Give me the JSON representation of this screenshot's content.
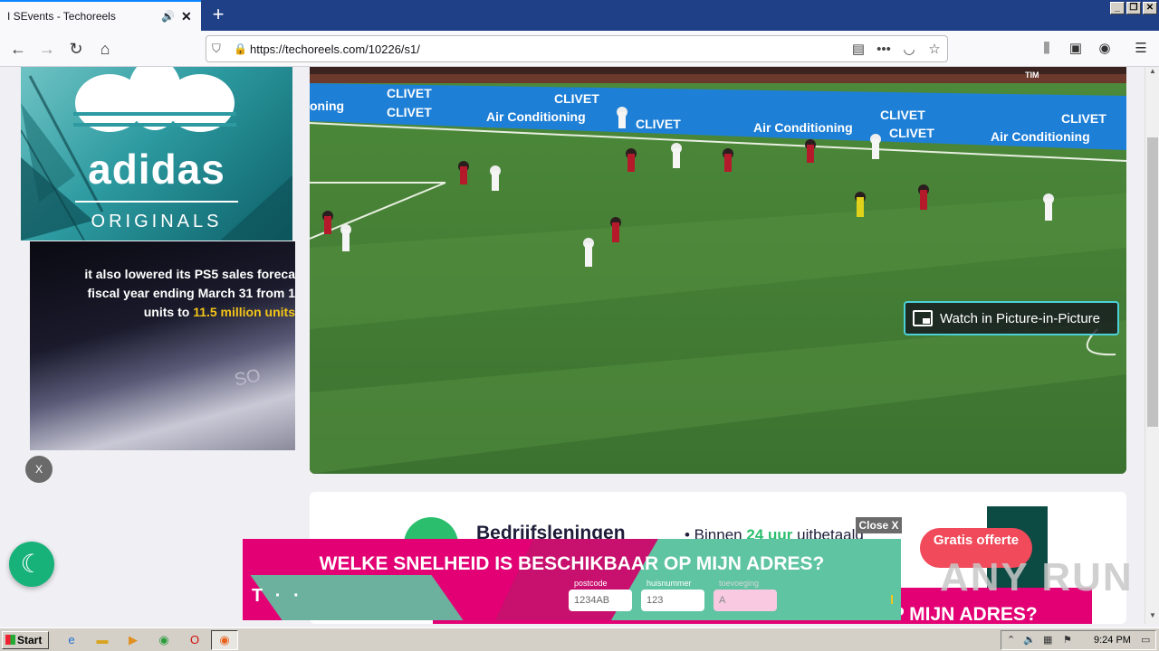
{
  "browser": {
    "tab_title": "I SEvents - Techoreels",
    "tab_speaker_icon": "speaker-icon",
    "tab_close": "✕",
    "new_tab": "+",
    "url": "https://techoreels.com/10226/s1/",
    "window_controls": [
      "_",
      "❐",
      "✕"
    ]
  },
  "ads": {
    "adidas_brand": "adidas",
    "adidas_sub": "ORIGINALS",
    "ps5_line1": "it also lowered its PS5 sales foreca",
    "ps5_line2": "fiscal year ending March 31 from 1",
    "ps5_line3_a": "units",
    "ps5_line3_b": "to",
    "ps5_line3_c": "11.5 million units",
    "ps5_logo": "SO",
    "close_label": "X",
    "loan_title": "Bedrijfsleningen",
    "loan_bullet_prefix": "• Binnen",
    "loan_bullet_hours": "24 uur",
    "loan_bullet_suffix": "uitbetaald",
    "loan_cta": "Gratis offerte",
    "close_x_label": "Close X",
    "telekom_headline": "WELKE SNELHEID IS BESCHIKBAAR OP MIJN ADRES?",
    "telekom_back_text": "WELKE SNELHEID IS BESCHIKBAAR OP MIJN ADRES?",
    "telekom_logo": "T · ·",
    "postcode_label": "postcode",
    "postcode_value": "1234AB",
    "huisnummer_label": "huisnummer",
    "huisnummer_value": "123",
    "toevoeging_label": "toevoeging",
    "toevoeging_value": "A"
  },
  "video": {
    "pip_label": "Watch in Picture-in-Picture",
    "board_clivet": "CLIVET",
    "board_air": "Air Conditioning",
    "board_oning": "oning",
    "board_tim": "TIM"
  },
  "watermark": "ANY RUN",
  "taskbar": {
    "start_label": "Start",
    "time": "9:24 PM"
  }
}
